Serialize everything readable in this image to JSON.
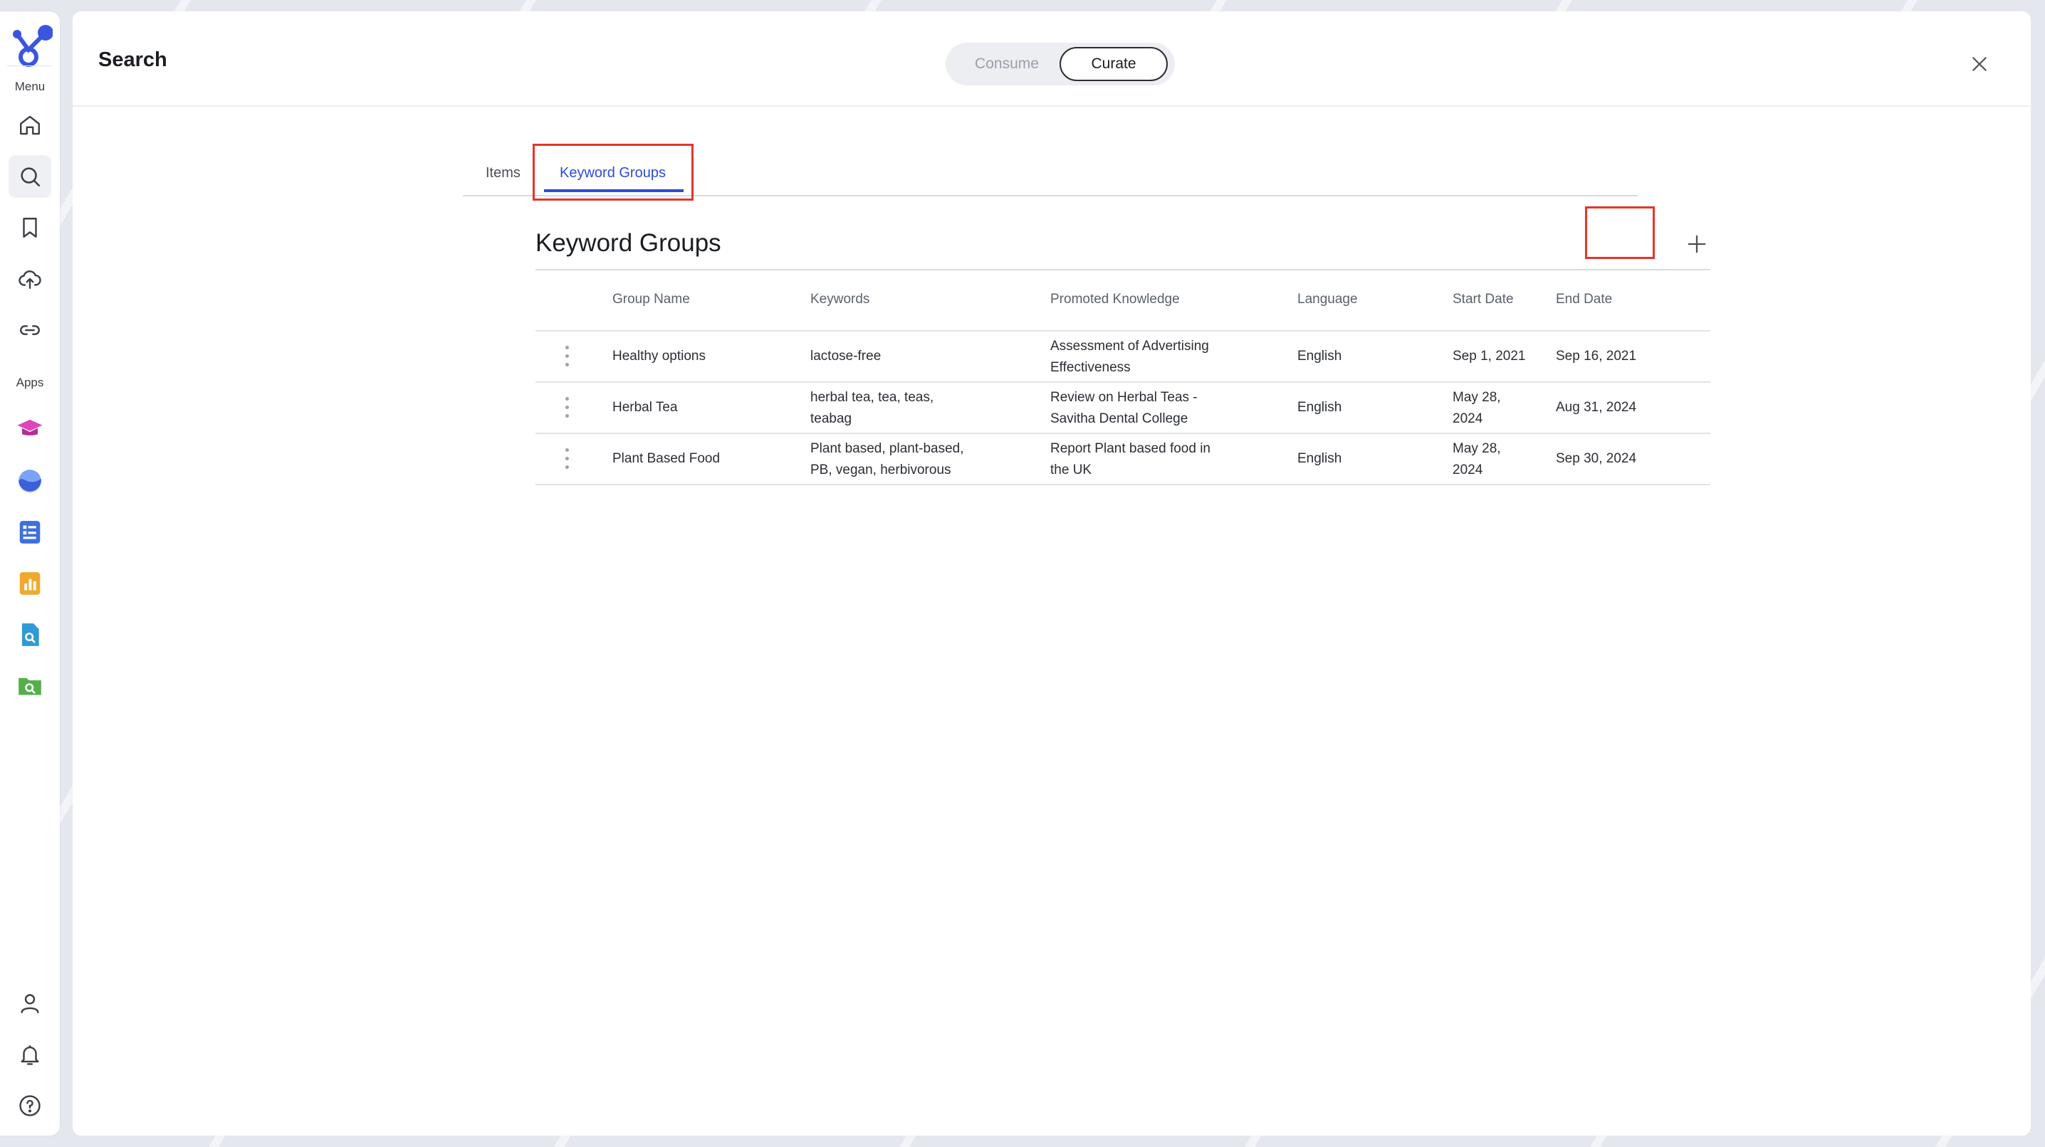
{
  "rail": {
    "menu_label": "Menu",
    "apps_label": "Apps",
    "nav": [
      {
        "name": "home-icon"
      },
      {
        "name": "search-icon",
        "active": true
      },
      {
        "name": "bookmark-icon"
      },
      {
        "name": "upload-cloud-icon"
      },
      {
        "name": "link-icon"
      }
    ],
    "apps": [
      {
        "name": "graduation-cap-app-icon",
        "color": "#d93fb0"
      },
      {
        "name": "wave-app-icon",
        "color": "#5b7ff0"
      },
      {
        "name": "document-list-app-icon",
        "color": "#3d6fe0"
      },
      {
        "name": "bar-chart-app-icon",
        "color": "#f0a92e"
      },
      {
        "name": "file-search-app-icon",
        "color": "#2f9bd6"
      },
      {
        "name": "folder-search-app-icon",
        "color": "#55b04a"
      }
    ],
    "bottom": [
      {
        "name": "user-icon"
      },
      {
        "name": "bell-icon"
      },
      {
        "name": "help-icon"
      }
    ]
  },
  "header": {
    "title": "Search",
    "modes": {
      "consume": "Consume",
      "curate": "Curate",
      "selected": "Curate"
    }
  },
  "tabs": {
    "items": "Items",
    "keyword_groups": "Keyword Groups",
    "active": "Keyword Groups"
  },
  "section": {
    "title": "Keyword Groups",
    "add_symbol": "+"
  },
  "table": {
    "columns": [
      "Group Name",
      "Keywords",
      "Promoted Knowledge",
      "Language",
      "Start Date",
      "End Date"
    ],
    "rows": [
      {
        "group_name": "Healthy options",
        "keywords": [
          "lactose-free"
        ],
        "promoted": [
          "Assessment of Advertising",
          "Effectiveness"
        ],
        "language": "English",
        "start": [
          "Sep 1, 2021"
        ],
        "end": "Sep 16, 2021"
      },
      {
        "group_name": "Herbal Tea",
        "keywords": [
          "herbal tea, tea, teas,",
          "teabag"
        ],
        "promoted": [
          "Review on Herbal Teas -",
          "Savitha Dental College"
        ],
        "language": "English",
        "start": [
          "May 28,",
          "2024"
        ],
        "end": "Aug 31, 2024"
      },
      {
        "group_name": "Plant Based Food",
        "keywords": [
          "Plant based, plant-based,",
          "PB, vegan, herbivorous"
        ],
        "promoted": [
          "Report Plant based food in",
          "the UK"
        ],
        "language": "English",
        "start": [
          "May 28,",
          "2024"
        ],
        "end": "Sep 30, 2024"
      }
    ]
  },
  "colors": {
    "accent": "#2d4bd6",
    "highlight": "#e4352b"
  }
}
